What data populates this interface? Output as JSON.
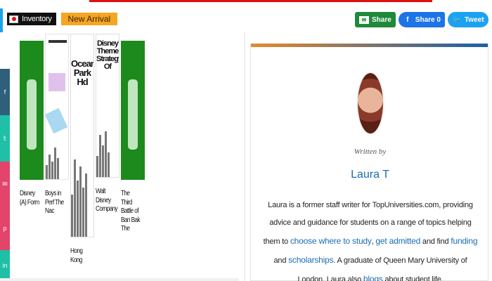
{
  "tags": {
    "inventory": "Inventory",
    "new_arrival": "New Arrival"
  },
  "share": {
    "share_label": "Share",
    "facebook_label": "Share 0",
    "tweet_label": "Tweet"
  },
  "side_social": [
    {
      "icon": "facebook-icon",
      "color": "#2f5f7a"
    },
    {
      "icon": "twitter-icon",
      "color": "#1fbfa8"
    },
    {
      "icon": "email-icon",
      "color": "#e3446a"
    },
    {
      "icon": "pinterest-icon",
      "color": "#e3446a"
    },
    {
      "icon": "linkedin-icon",
      "color": "#1fbfa8"
    }
  ],
  "books": [
    {
      "title": "Disney (A) Form"
    },
    {
      "title": "Boys in Perf The Nac"
    },
    {
      "title": "Hong Kong"
    },
    {
      "title": "Walt Disney Company"
    },
    {
      "title": "The Third Battle of Ban Bak The"
    }
  ],
  "covers": {
    "book3_title": "Ocean Park Hd",
    "book4_title": "Disney Theme Strategy Of"
  },
  "author": {
    "written_by": "Written by",
    "name": "Laura T",
    "bio_1": "Laura is a former staff writer for TopUniversities.com, providing advice and guidance for students on a range of topics helping them to ",
    "link_choose": "choose where to study",
    "bio_2": ", ",
    "link_admitted": "get admitted",
    "bio_3": " and find ",
    "link_funding": "funding",
    "bio_4": " and ",
    "link_scholarships": "scholarships",
    "bio_5": ". A graduate of Queen Mary University of London, Laura also ",
    "link_blogs": "blogs",
    "bio_6": " about student life."
  }
}
